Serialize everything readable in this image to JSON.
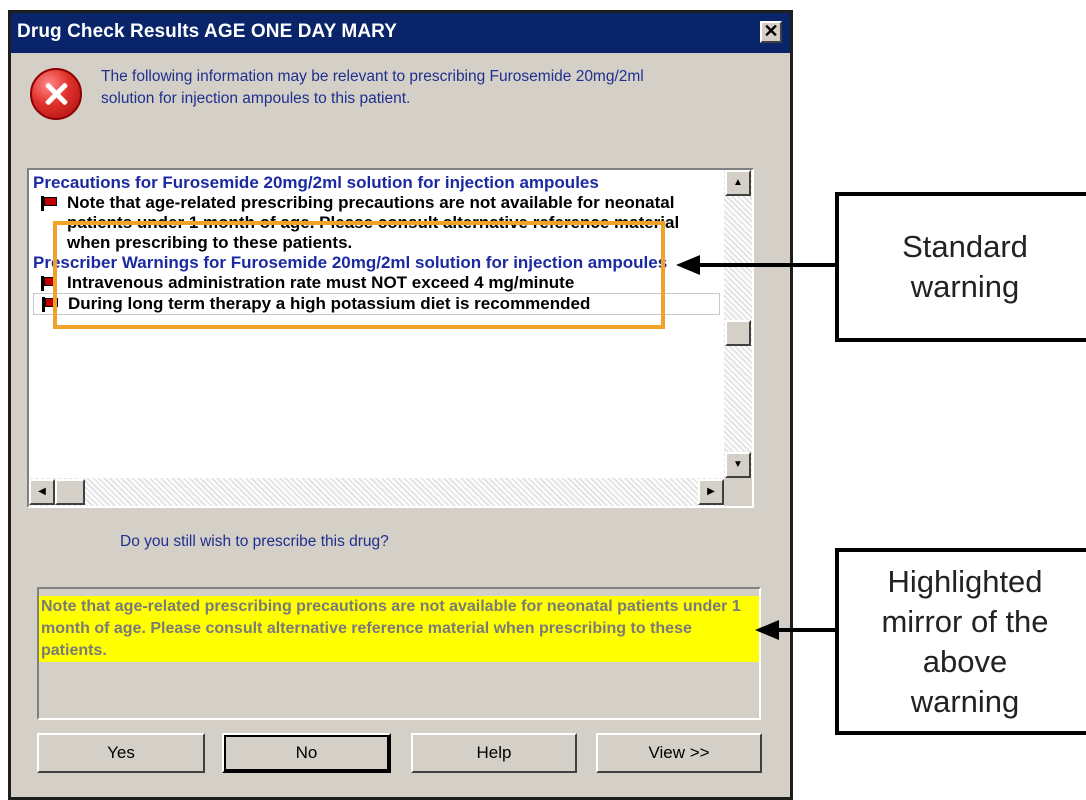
{
  "window": {
    "title": "Drug Check Results  AGE ONE DAY MARY",
    "close_label": "✕"
  },
  "info_text": "The following information may be relevant to prescribing Furosemide 20mg/2ml solution for injection ampoules to this patient.",
  "results": {
    "heading_1": "Precautions for Furosemide 20mg/2ml solution for injection ampoules",
    "item_1": "Note that age-related prescribing precautions are not available for neonatal patients under 1 month of age. Please consult alternative reference material when prescribing to these patients.",
    "heading_2": "Prescriber Warnings for Furosemide 20mg/2ml solution for injection ampoules",
    "item_2": "Intravenous administration rate must NOT exceed 4 mg/minute",
    "item_3": "During long term therapy a high potassium diet is recommended"
  },
  "question": "Do you still wish to prescribe this drug?",
  "mirror_text": "Note that age-related prescribing precautions are not available for neonatal patients under 1 month of age. Please consult alternative reference material when prescribing to these patients.",
  "buttons": {
    "yes": "Yes",
    "no": "No",
    "help": "Help",
    "view": "View >>"
  },
  "callouts": {
    "standard_line1": "Standard",
    "standard_line2": "warning",
    "mirror_line1": "Highlighted",
    "mirror_line2": "mirror of the",
    "mirror_line3": "above",
    "mirror_line4": "warning"
  },
  "colors": {
    "title_bar": "#0a246a",
    "highlight_box": "#f2a229",
    "mirror_background": "#ffff00",
    "heading_text": "#1c2aa2"
  }
}
